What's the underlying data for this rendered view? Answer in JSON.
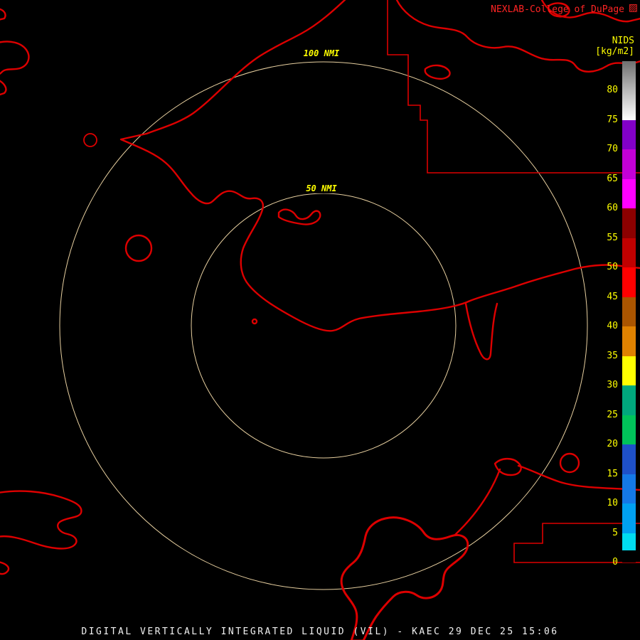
{
  "header": {
    "brand": "NEXLAB-College of DuPage",
    "logo_glyph": "▨",
    "logo_icon": "nexlab-logo-icon",
    "scale_title": "NIDS",
    "scale_units": "[kg/m2]"
  },
  "footer": {
    "caption": "DIGITAL VERTICALLY INTEGRATED LIQUID (VIL) - KAEC 29 DEC 25 15:06"
  },
  "map": {
    "rings": [
      {
        "label": "100 NMI"
      },
      {
        "label": "50 NMI"
      }
    ]
  },
  "colorbar": {
    "min": 0,
    "max": 85,
    "ticks": [
      80,
      75,
      70,
      65,
      60,
      55,
      50,
      45,
      40,
      35,
      30,
      25,
      20,
      15,
      10,
      5,
      0
    ],
    "segments": [
      {
        "from": 80,
        "to": 85,
        "color": "linear-gradient(#6f6f6f,#b9b9b9)"
      },
      {
        "from": 75,
        "to": 80,
        "color": "linear-gradient(#b9b9b9,#ffffff)"
      },
      {
        "from": 70,
        "to": 75,
        "color": "#8200c8"
      },
      {
        "from": 65,
        "to": 70,
        "color": "#c300d6"
      },
      {
        "from": 60,
        "to": 65,
        "color": "#ff00ff"
      },
      {
        "from": 55,
        "to": 60,
        "color": "#8c0000"
      },
      {
        "from": 50,
        "to": 55,
        "color": "#c00000"
      },
      {
        "from": 45,
        "to": 50,
        "color": "#ff0000"
      },
      {
        "from": 40,
        "to": 45,
        "color": "#aa5500"
      },
      {
        "from": 35,
        "to": 40,
        "color": "#e08200"
      },
      {
        "from": 30,
        "to": 35,
        "color": "#ffff00"
      },
      {
        "from": 25,
        "to": 30,
        "color": "#00a87d"
      },
      {
        "from": 20,
        "to": 25,
        "color": "#00c35a"
      },
      {
        "from": 15,
        "to": 20,
        "color": "#1e50c8"
      },
      {
        "from": 10,
        "to": 15,
        "color": "#1478e6"
      },
      {
        "from": 5,
        "to": 10,
        "color": "#00a0f0"
      },
      {
        "from": 2,
        "to": 5,
        "color": "#00dcf0"
      },
      {
        "from": 0,
        "to": 2,
        "color": "#000000"
      }
    ]
  },
  "colors": {
    "background": "#000000",
    "outline": "#dd0000",
    "ring": "#e8d0a0",
    "label": "#ffff00",
    "brand": "#ff2424",
    "caption": "#f2f2f2"
  }
}
